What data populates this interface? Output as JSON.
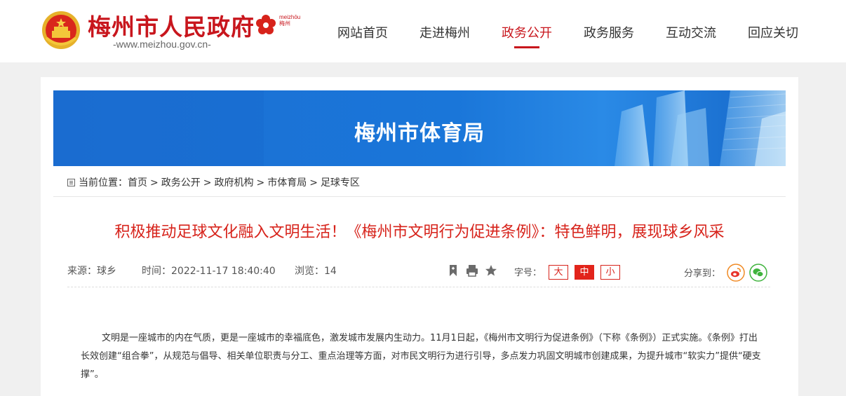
{
  "header": {
    "site_title": "梅州市人民政府",
    "site_url": "-www.meizhou.gov.cn-",
    "logo_text_line1": "meizhōu",
    "logo_text_line2": "梅州",
    "nav": [
      {
        "label": "网站首页",
        "active": false
      },
      {
        "label": "走进梅州",
        "active": false
      },
      {
        "label": "政务公开",
        "active": true
      },
      {
        "label": "政务服务",
        "active": false
      },
      {
        "label": "互动交流",
        "active": false
      },
      {
        "label": "回应关切",
        "active": false
      }
    ]
  },
  "banner": {
    "title": "梅州市体育局"
  },
  "breadcrumb": {
    "prefix": "当前位置：",
    "items": [
      "首页",
      "政务公开",
      "政府机构",
      "市体育局",
      "足球专区"
    ],
    "separator": ">"
  },
  "article": {
    "title": "积极推动足球文化融入文明生活！《梅州市文明行为促进条例》：特色鲜明，展现球乡风采",
    "source": "来源：球乡",
    "time": "时间：2022-11-17 18:40:40",
    "views": "浏览：14",
    "font_size_label": "字号：",
    "font_sizes": [
      "大",
      "中",
      "小"
    ],
    "font_size_selected": "中",
    "share_label": "分享到：",
    "body": "文明是一座城市的内在气质，更是一座城市的幸福底色，激发城市发展内生动力。11月1日起，《梅州市文明行为促进条例》（下称《条例》）正式实施。《条例》打出长效创建“组合拳”，从规范与倡导、相关单位职责与分工、重点治理等方面，对市民文明行为进行引导，多点发力巩固文明城市创建成果，为提升城市“软实力”提供“硬支撑”。"
  },
  "colors": {
    "brand_red": "#c8161d",
    "title_red": "#d7231b",
    "banner_blue": "#1a76d9",
    "weibo_orange": "#f08a24",
    "wechat_green": "#3fb33d"
  },
  "icons": [
    "national-emblem-icon",
    "flower-logo-icon",
    "breadcrumb-icon",
    "bookmark-icon",
    "print-icon",
    "star-icon",
    "weibo-icon",
    "wechat-icon"
  ]
}
